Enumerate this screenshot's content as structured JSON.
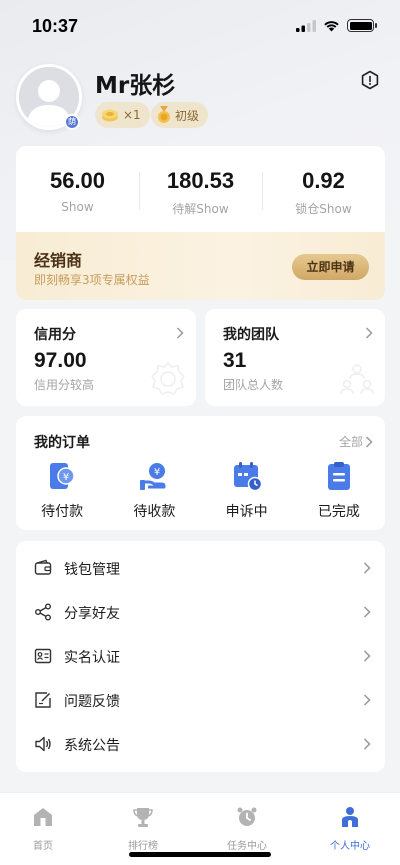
{
  "status": {
    "time": "10:37"
  },
  "profile": {
    "name": "Mr张杉",
    "avatar_badge": "荫",
    "count_chip": "×1",
    "level_chip": "初级"
  },
  "stats": [
    {
      "value": "56.00",
      "label": "Show"
    },
    {
      "value": "180.53",
      "label": "待解Show"
    },
    {
      "value": "0.92",
      "label": "锁仓Show"
    }
  ],
  "dealer": {
    "title": "经销商",
    "subtitle": "即刻畅享3项专属权益",
    "apply_label": "立即申请"
  },
  "credit": {
    "title": "信用分",
    "value": "97.00",
    "label": "信用分较高"
  },
  "team": {
    "title": "我的团队",
    "value": "31",
    "label": "团队总人数"
  },
  "orders": {
    "title": "我的订单",
    "all_label": "全部",
    "items": [
      {
        "label": "待付款",
        "icon": "wallet-yuan-icon"
      },
      {
        "label": "待收款",
        "icon": "hand-yuan-icon"
      },
      {
        "label": "申诉中",
        "icon": "calendar-clock-icon"
      },
      {
        "label": "已完成",
        "icon": "clipboard-check-icon"
      }
    ]
  },
  "menu": [
    {
      "label": "钱包管理",
      "icon": "wallet-icon"
    },
    {
      "label": "分享好友",
      "icon": "share-icon"
    },
    {
      "label": "实名认证",
      "icon": "id-card-icon"
    },
    {
      "label": "问题反馈",
      "icon": "feedback-icon"
    },
    {
      "label": "系统公告",
      "icon": "speaker-icon"
    }
  ],
  "tabs": [
    {
      "label": "首页",
      "icon": "home-icon",
      "active": false
    },
    {
      "label": "排行榜",
      "icon": "trophy-icon",
      "active": false
    },
    {
      "label": "任务中心",
      "icon": "alarm-clock-icon",
      "active": false
    },
    {
      "label": "个人中心",
      "icon": "person-icon",
      "active": true
    }
  ],
  "colors": {
    "accent": "#3f6ed8",
    "order_icon": "#4a7be8",
    "gold": "#cfa867",
    "background": "#f3f4f6"
  }
}
